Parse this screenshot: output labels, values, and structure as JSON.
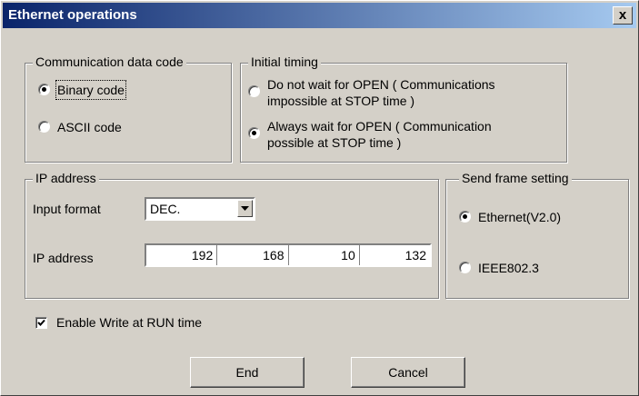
{
  "window": {
    "title": "Ethernet operations",
    "close_label": "x"
  },
  "comm_code": {
    "legend": "Communication data code",
    "options": [
      {
        "label": "Binary code",
        "selected": true
      },
      {
        "label": "ASCII code",
        "selected": false
      }
    ]
  },
  "initial_timing": {
    "legend": "Initial timing",
    "options": [
      {
        "line1": "Do not wait for OPEN ( Communications",
        "line2": "impossible at STOP time )",
        "selected": false
      },
      {
        "line1": "Always wait for OPEN ( Communication",
        "line2": "possible at STOP time )",
        "selected": true
      }
    ]
  },
  "ip": {
    "legend": "IP address",
    "input_format_label": "Input format",
    "input_format_value": "DEC.",
    "address_label": "IP address",
    "octets": [
      "192",
      "168",
      "10",
      "132"
    ]
  },
  "send_frame": {
    "legend": "Send frame setting",
    "options": [
      {
        "label": "Ethernet(V2.0)",
        "selected": true
      },
      {
        "label": "IEEE802.3",
        "selected": false
      }
    ]
  },
  "enable_write": {
    "label": "Enable Write at RUN time",
    "checked": true
  },
  "buttons": {
    "end": "End",
    "cancel": "Cancel"
  }
}
